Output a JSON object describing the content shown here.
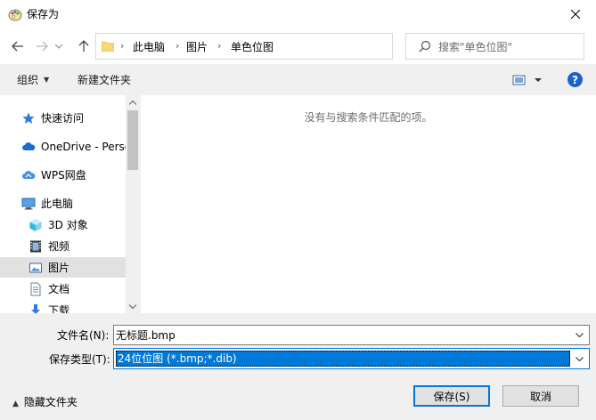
{
  "window": {
    "title": "保存为"
  },
  "address": {
    "crumbs": [
      "此电脑",
      "图片",
      "单色位图"
    ],
    "separator": "›"
  },
  "search": {
    "placeholder": "搜索\"单色位图\""
  },
  "toolbar": {
    "organize": "组织",
    "new_folder": "新建文件夹",
    "help": "?"
  },
  "sidebar": {
    "items": [
      {
        "label": "快速访问",
        "icon": "star-icon"
      },
      {
        "label": "OneDrive - Perso",
        "icon": "cloud-icon"
      },
      {
        "label": "WPS网盘",
        "icon": "wps-cloud-icon"
      },
      {
        "label": "此电脑",
        "icon": "computer-icon"
      },
      {
        "label": "3D 对象",
        "icon": "cube-icon"
      },
      {
        "label": "视频",
        "icon": "video-icon"
      },
      {
        "label": "图片",
        "icon": "pictures-icon",
        "selected": true
      },
      {
        "label": "文档",
        "icon": "document-icon"
      },
      {
        "label": "下载",
        "icon": "download-icon"
      }
    ]
  },
  "content": {
    "empty_message": "没有与搜索条件匹配的项。"
  },
  "form": {
    "filename_label": "文件名(N):",
    "filename_value": "无标题.bmp",
    "filetype_label": "保存类型(T):",
    "filetype_value": "24位位图 (*.bmp;*.dib)"
  },
  "footer": {
    "hide_folders": "隐藏文件夹",
    "save_label": "保存(S)",
    "cancel_label": "取消"
  },
  "colors": {
    "accent": "#0078d7",
    "selected_bg": "#e1e1e1",
    "panel_bg": "#f0f0f0"
  }
}
